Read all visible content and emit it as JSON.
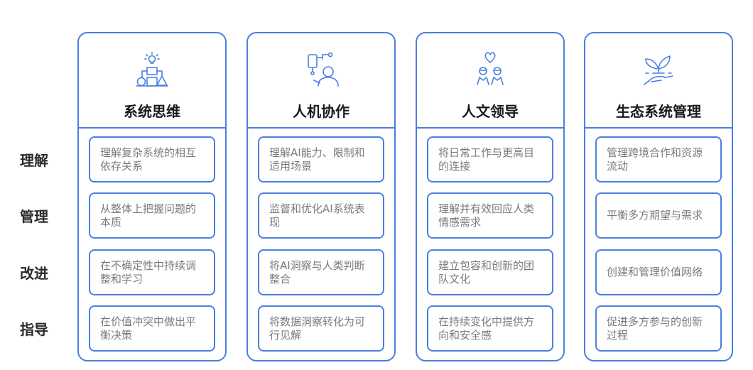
{
  "rows": [
    "理解",
    "管理",
    "改进",
    "指导"
  ],
  "columns": [
    {
      "title": "系统思维",
      "icon": "system-structure-icon",
      "items": [
        "理解复杂系统的相互依存关系",
        "从整体上把握问题的本质",
        "在不确定性中持续调整和学习",
        "在价值冲突中做出平衡决策"
      ]
    },
    {
      "title": "人机协作",
      "icon": "human-robot-icon",
      "items": [
        "理解AI能力、限制和适用场景",
        "监督和优化AI系统表现",
        "将AI洞察与人类判断整合",
        "将数据洞察转化为可行见解"
      ]
    },
    {
      "title": "人文领导",
      "icon": "people-heart-icon",
      "items": [
        "将日常工作与更高目的连接",
        "理解并有效回应人类情感需求",
        "建立包容和创新的团队文化",
        "在持续变化中提供方向和安全感"
      ]
    },
    {
      "title": "生态系统管理",
      "icon": "plant-hand-icon",
      "items": [
        "管理跨境合作和资源流动",
        "平衡多方期望与需求",
        "创建和管理价值网络",
        "促进多方参与的创新过程"
      ]
    }
  ],
  "colors": {
    "accent": "#4a7fe0",
    "cell_text": "#7a7a7a",
    "title_text": "#1a1a1a"
  }
}
